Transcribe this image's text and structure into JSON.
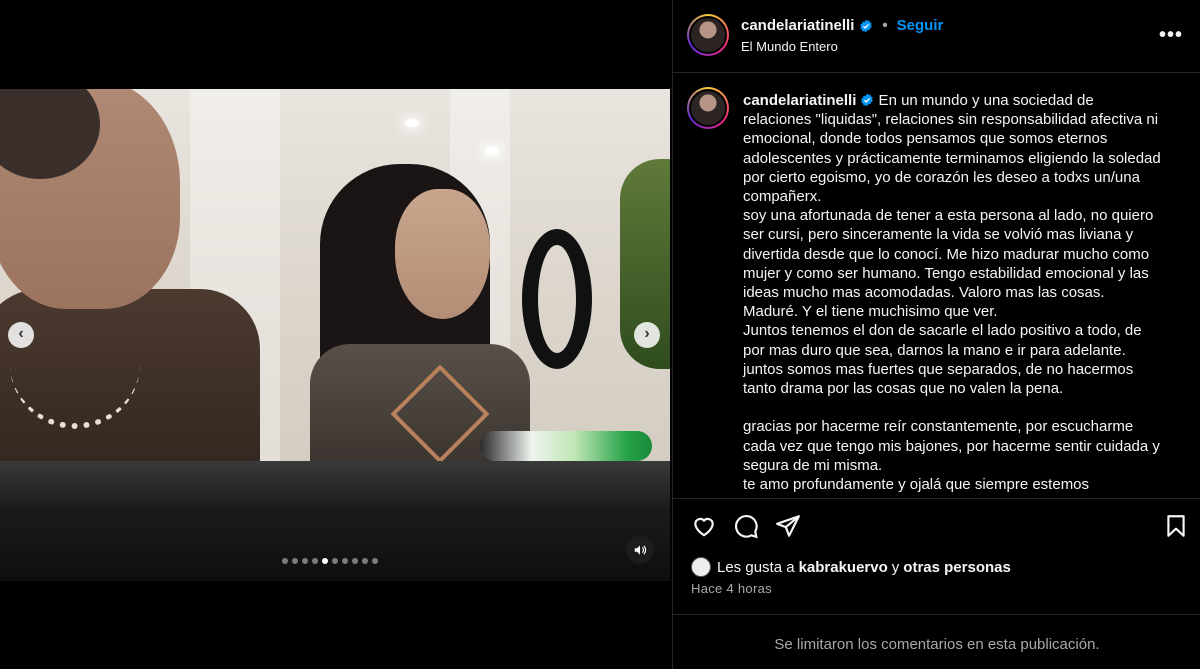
{
  "post": {
    "username": "candelariatinelli",
    "follow_label": "Seguir",
    "separator": "•",
    "location": "El Mundo Entero",
    "more_label": "•••",
    "verified": true
  },
  "media": {
    "carousel_total": 10,
    "carousel_active": 5,
    "prev_label": "‹",
    "next_label": "›"
  },
  "caption": {
    "username": "candelariatinelli",
    "text": " En un mundo y una sociedad de relaciones \"liquidas\", relaciones sin responsabilidad afectiva ni emocional, donde todos pensamos que somos eternos adolescentes y prácticamente terminamos eligiendo la soledad por cierto egoismo, yo de corazón les deseo a todxs un/una compañerx.\nsoy una afortunada de tener a esta persona al lado, no quiero ser cursi, pero sinceramente la vida se volvió mas liviana y divertida desde que lo conocí. Me hizo madurar mucho como mujer y como ser humano. Tengo estabilidad emocional y las ideas mucho mas acomodadas. Valoro mas las cosas. Maduré. Y el tiene muchisimo que ver.\nJuntos tenemos el don de sacarle el lado positivo a todo, de por mas duro que sea, darnos la mano e ir para adelante.\njuntos somos mas fuertes que separados, de no hacermos tanto drama por las cosas que no valen la pena.\n\ngracias por hacerme reír constantemente, por escucharme cada vez que tengo mis bajones, por hacerme sentir cuidada y segura de mi misma.\nte amo profundamente y ojalá que siempre estemos"
  },
  "likes": {
    "prefix": "Les gusta a",
    "user": "kabrakuervo",
    "conjunction": "y",
    "others": "otras personas"
  },
  "timestamp": "Hace 4 horas",
  "comments_limited": "Se limitaron los comentarios en esta publicación.",
  "colors": {
    "background": "#000000",
    "text": "#f5f5f5",
    "secondary_text": "#a8a8a8",
    "link_blue": "#0095f6",
    "verified_blue": "#0095f6",
    "divider": "#262626"
  },
  "icons": [
    "heart-icon",
    "comment-icon",
    "share-icon",
    "bookmark-icon",
    "verified-icon",
    "more-icon",
    "speaker-icon",
    "chevron-left-icon",
    "chevron-right-icon"
  ]
}
